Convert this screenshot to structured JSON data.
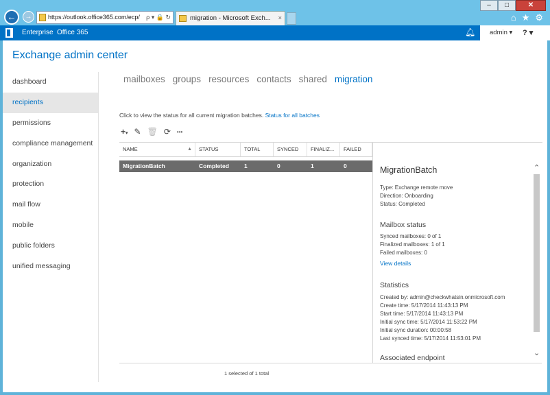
{
  "browser": {
    "window_controls": [
      "–",
      "□",
      "✕"
    ],
    "url": "https://outlook.office365.com/ecp/",
    "url_tools": "ρ ▾ 🔒 ↻",
    "tab_title": "migration - Microsoft Exch...",
    "tab_close": "×",
    "icons": [
      "home-icon",
      "star-icon",
      "gear-icon"
    ]
  },
  "topbar": {
    "link1": "Enterprise",
    "link2": "Office 365",
    "user": "admin ▾",
    "help": "? ▾"
  },
  "page_title": "Exchange admin center",
  "leftnav": [
    {
      "label": "dashboard",
      "active": false
    },
    {
      "label": "recipients",
      "active": true
    },
    {
      "label": "permissions",
      "active": false
    },
    {
      "label": "compliance management",
      "active": false
    },
    {
      "label": "organization",
      "active": false
    },
    {
      "label": "protection",
      "active": false
    },
    {
      "label": "mail flow",
      "active": false
    },
    {
      "label": "mobile",
      "active": false
    },
    {
      "label": "public folders",
      "active": false
    },
    {
      "label": "unified messaging",
      "active": false
    }
  ],
  "tabs": [
    {
      "label": "mailboxes",
      "active": false
    },
    {
      "label": "groups",
      "active": false
    },
    {
      "label": "resources",
      "active": false
    },
    {
      "label": "contacts",
      "active": false
    },
    {
      "label": "shared",
      "active": false
    },
    {
      "label": "migration",
      "active": true
    }
  ],
  "info": {
    "text": "Click to view the status for all current migration batches.",
    "link": "Status for all batches"
  },
  "toolbar": {
    "add": "+",
    "add_caret": "▾",
    "edit": "✎",
    "delete": "🗑",
    "refresh": "⟳",
    "more": "•••"
  },
  "grid": {
    "columns": [
      "NAME",
      "STATUS",
      "TOTAL",
      "SYNCED",
      "FINALIZ...",
      "FAILED"
    ],
    "sort_indicator": "▲",
    "rows": [
      {
        "name": "MigrationBatch",
        "status": "Completed",
        "total": "1",
        "synced": "0",
        "finalized": "1",
        "failed": "0"
      }
    ],
    "footer": "1 selected of 1 total"
  },
  "detail": {
    "title": "MigrationBatch",
    "type": "Type: Exchange remote move",
    "direction": "Direction: Onboarding",
    "status": "Status: Completed",
    "mailbox_status_header": "Mailbox status",
    "synced_mailboxes": "Synced mailboxes: 0 of 1",
    "finalized_mailboxes": "Finalized mailboxes: 1 of 1",
    "failed_mailboxes": "Failed mailboxes: 0",
    "view_details": "View details",
    "statistics_header": "Statistics",
    "created_by": "Created by: admin@checkwhatsin.onmicrosoft.com",
    "create_time": "Create time: 5/17/2014 11:43:13 PM",
    "start_time": "Start time: 5/17/2014 11:43:13 PM",
    "initial_sync_time": "Initial sync time: 5/17/2014 11:53:22 PM",
    "initial_sync_duration": "Initial sync duration: 00:00:58",
    "last_synced_time": "Last synced time: 5/17/2014 11:53:01 PM",
    "associated_endpoint": "Associated endpoint",
    "scroll_up": "⌃",
    "scroll_down": "⌄"
  }
}
